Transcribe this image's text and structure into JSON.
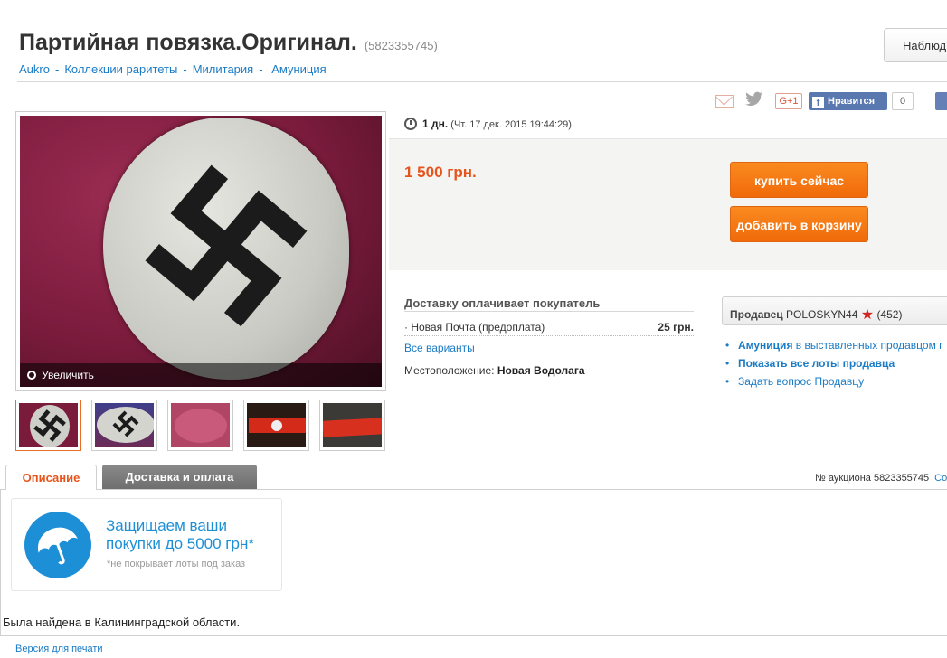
{
  "header": {
    "title": "Партийная повязка.Оригинал.",
    "lot_id": "(5823355745)",
    "watch_label": "Наблюд"
  },
  "breadcrumbs": [
    {
      "label": "Aukro"
    },
    {
      "label": "Коллекции раритеты"
    },
    {
      "label": "Милитария"
    },
    {
      "label": "Амуниция"
    }
  ],
  "social": {
    "gplus_label": "G+1",
    "like_label": "Нравится",
    "like_count": "0"
  },
  "gallery": {
    "zoom_label": "Увеличить",
    "thumbnail_count": 5,
    "active_index": 0
  },
  "timer": {
    "remaining": "1 дн.",
    "ends_at": "(Чт. 17 дек. 2015 19:44:29)"
  },
  "offer": {
    "price": "1 500 грн.",
    "buy_now_label": "купить сейчас",
    "add_to_cart_label": "добавить в корзину"
  },
  "shipping": {
    "title": "Доставку оплачивает покупатель",
    "method": "Новая Почта (предоплата)",
    "cost": "25 грн.",
    "all_variants_label": "Все варианты",
    "location_label": "Местоположение:",
    "location_value": "Новая Водолага"
  },
  "seller": {
    "label": "Продавец",
    "name": "POLOSKYN44",
    "rating": "(452)",
    "link_category_bold": "Амуниция",
    "link_category_rest": "в выставленных продавцом г",
    "link_all_lots": "Показать все лоты продавца",
    "link_ask": "Задать вопрос Продавцу"
  },
  "tabs": {
    "description": "Описание",
    "shipping_payment": "Доставка и оплата",
    "auction_number": "№ аукциона 5823355745",
    "more": "Co"
  },
  "protection": {
    "line1": "Защищаем ваши",
    "line2": "покупки до 5000 грн*",
    "note": "*не покрывает лоты под заказ"
  },
  "description": {
    "text": "Была найдена в Калининградской области."
  },
  "footer": {
    "print_label": "Версия для печати"
  },
  "colors": {
    "accent_orange": "#e7541b",
    "button_orange": "#f47c16",
    "link_blue": "#1a7bc5",
    "protect_blue": "#1d8fd6"
  }
}
